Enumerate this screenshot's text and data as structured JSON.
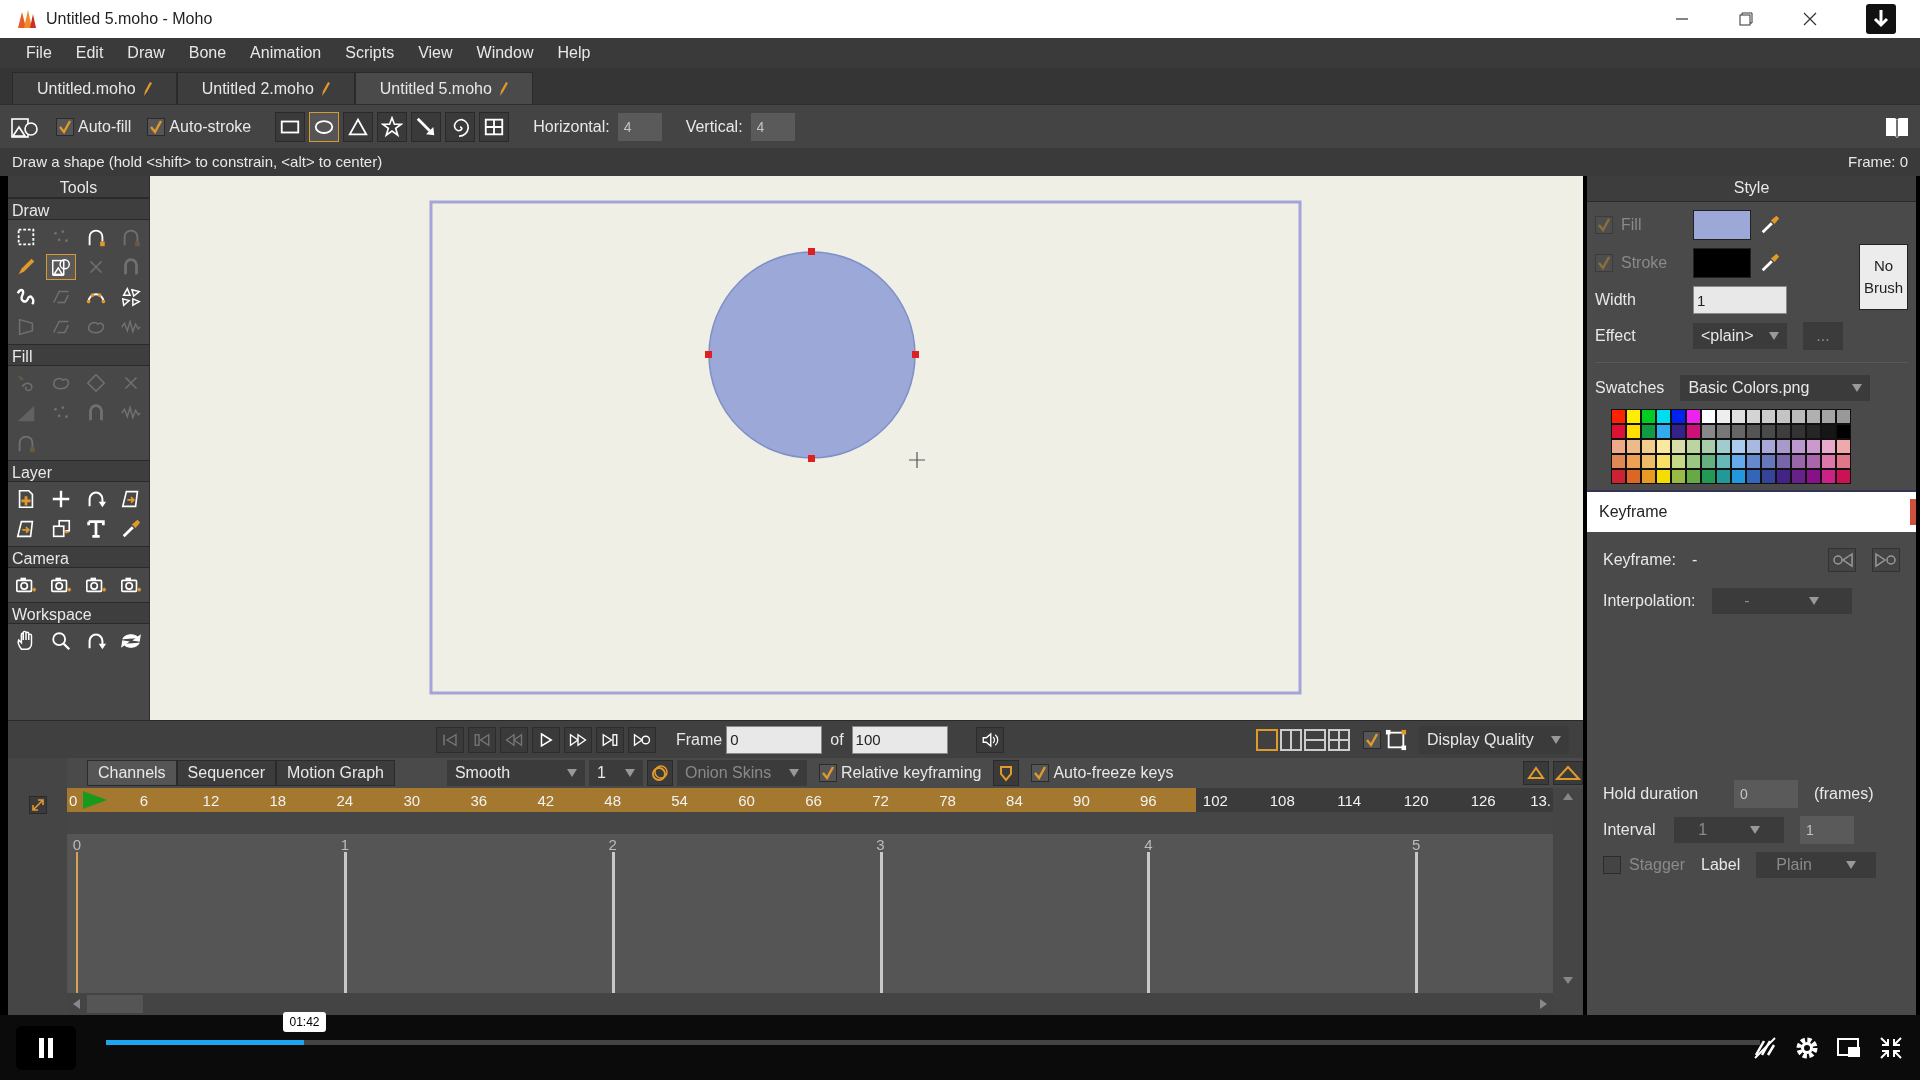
{
  "window": {
    "title": "Untitled 5.moho - Moho"
  },
  "menu": [
    "File",
    "Edit",
    "Draw",
    "Bone",
    "Animation",
    "Scripts",
    "View",
    "Window",
    "Help"
  ],
  "doc_tabs": [
    {
      "label": "Untitled.moho",
      "selected": false
    },
    {
      "label": "Untitled 2.moho",
      "selected": false
    },
    {
      "label": "Untitled 5.moho",
      "selected": true
    }
  ],
  "toolbar": {
    "auto_fill": {
      "label": "Auto-fill",
      "checked": true
    },
    "auto_stroke": {
      "label": "Auto-stroke",
      "checked": true
    },
    "shapes": [
      {
        "kind": "rect",
        "selected": false
      },
      {
        "kind": "ellipse",
        "selected": true
      },
      {
        "kind": "triangle",
        "selected": false
      },
      {
        "kind": "star",
        "selected": false
      },
      {
        "kind": "arrow",
        "selected": false
      },
      {
        "kind": "spiral",
        "selected": false
      },
      {
        "kind": "grid",
        "selected": false
      }
    ],
    "horizontal": {
      "label": "Horizontal:",
      "value": "4"
    },
    "vertical": {
      "label": "Vertical:",
      "value": "4"
    }
  },
  "status": {
    "hint": "Draw a shape (hold <shift> to constrain, <alt> to center)",
    "frame": "Frame: 0"
  },
  "tools": {
    "title": "Tools",
    "sections": [
      {
        "title": "Draw",
        "tools": [
          {
            "kind": "marquee",
            "selected": false,
            "disabled": false
          },
          {
            "kind": "dots",
            "selected": false,
            "disabled": true
          },
          {
            "kind": "arc",
            "selected": false,
            "disabled": false
          },
          {
            "kind": "arc",
            "selected": false,
            "disabled": true
          },
          {
            "kind": "pencil",
            "selected": false,
            "disabled": false
          },
          {
            "kind": "shape",
            "selected": true,
            "disabled": false
          },
          {
            "kind": "cross",
            "selected": false,
            "disabled": true
          },
          {
            "kind": "magnet",
            "selected": false,
            "disabled": true
          },
          {
            "kind": "freehand",
            "selected": false,
            "disabled": false
          },
          {
            "kind": "lines",
            "selected": false,
            "disabled": true
          },
          {
            "kind": "curvature",
            "selected": false,
            "disabled": false
          },
          {
            "kind": "triangles",
            "selected": false,
            "disabled": false
          },
          {
            "kind": "trapezoid",
            "selected": false,
            "disabled": true
          },
          {
            "kind": "lines",
            "selected": false,
            "disabled": true
          },
          {
            "kind": "blob",
            "selected": false,
            "disabled": true
          },
          {
            "kind": "wave",
            "selected": false,
            "disabled": true
          }
        ]
      },
      {
        "title": "Fill",
        "tools": [
          {
            "kind": "lasso",
            "selected": false,
            "disabled": true
          },
          {
            "kind": "blob",
            "selected": false,
            "disabled": true
          },
          {
            "kind": "diamond",
            "selected": false,
            "disabled": true
          },
          {
            "kind": "cross",
            "selected": false,
            "disabled": true
          },
          {
            "kind": "gradient",
            "selected": false,
            "disabled": true
          },
          {
            "kind": "dots",
            "selected": false,
            "disabled": true
          },
          {
            "kind": "magnet",
            "selected": false,
            "disabled": true
          },
          {
            "kind": "wave",
            "selected": false,
            "disabled": true
          },
          {
            "kind": "arc",
            "selected": false,
            "disabled": true
          }
        ]
      },
      {
        "title": "Layer",
        "tools": [
          {
            "kind": "layer-add",
            "selected": false,
            "disabled": false
          },
          {
            "kind": "plus",
            "selected": false,
            "disabled": false
          },
          {
            "kind": "rotate",
            "selected": false,
            "disabled": false
          },
          {
            "kind": "layer-tilt",
            "selected": false,
            "disabled": false
          },
          {
            "kind": "layer-tilt",
            "selected": false,
            "disabled": false
          },
          {
            "kind": "layers",
            "selected": false,
            "disabled": false
          },
          {
            "kind": "text",
            "selected": false,
            "disabled": false
          },
          {
            "kind": "dropper",
            "selected": false,
            "disabled": false
          }
        ]
      },
      {
        "title": "Camera",
        "tools": [
          {
            "kind": "camera",
            "selected": false,
            "disabled": false
          },
          {
            "kind": "camera",
            "selected": false,
            "disabled": false
          },
          {
            "kind": "camera",
            "selected": false,
            "disabled": false
          },
          {
            "kind": "camera",
            "selected": false,
            "disabled": false
          }
        ]
      },
      {
        "title": "Workspace",
        "tools": [
          {
            "kind": "hand",
            "selected": false,
            "disabled": false
          },
          {
            "kind": "zoom",
            "selected": false,
            "disabled": false
          },
          {
            "kind": "rotate",
            "selected": false,
            "disabled": false
          },
          {
            "kind": "orbit",
            "selected": false,
            "disabled": false
          }
        ]
      }
    ]
  },
  "style": {
    "title": "Style",
    "fill": {
      "label": "Fill",
      "checked": true,
      "color": "#9ba8d8"
    },
    "stroke": {
      "label": "Stroke",
      "checked": true,
      "color": "#000000"
    },
    "width": {
      "label": "Width",
      "value": "1"
    },
    "brush_button": "No Brush",
    "effect": {
      "label": "Effect",
      "value": "<plain>"
    },
    "more_button": "...",
    "swatches": {
      "label": "Swatches",
      "value": "Basic Colors.png",
      "items": [
        {
          "color": "#ff2200"
        },
        {
          "color": "#ffee00"
        },
        {
          "color": "#00cc22"
        },
        {
          "color": "#00ddee"
        },
        {
          "color": "#0022ee"
        },
        {
          "color": "#ee22ee"
        },
        {
          "color": "#ffffff"
        },
        {
          "color": "#eeeeee"
        },
        {
          "color": "#e0e0e0"
        },
        {
          "color": "#d4d4d4"
        },
        {
          "color": "#cccccc"
        },
        {
          "color": "#c4c4c4"
        },
        {
          "color": "#bbbbbb"
        },
        {
          "color": "#b0b0b0"
        },
        {
          "color": "#a4a4a4"
        },
        {
          "color": "#999999"
        },
        {
          "color": "#dd1133"
        },
        {
          "color": "#ffdd00"
        },
        {
          "color": "#119944"
        },
        {
          "color": "#33aaee"
        },
        {
          "color": "#332288"
        },
        {
          "color": "#cc1177"
        },
        {
          "color": "#888888"
        },
        {
          "color": "#777777"
        },
        {
          "color": "#666666"
        },
        {
          "color": "#555555"
        },
        {
          "color": "#4a4a4a"
        },
        {
          "color": "#3e3e3e"
        },
        {
          "color": "#333333"
        },
        {
          "color": "#262626"
        },
        {
          "color": "#161616"
        },
        {
          "color": "#000000"
        },
        {
          "color": "#eeaa88"
        },
        {
          "color": "#eebb88"
        },
        {
          "color": "#f2cc8c"
        },
        {
          "color": "#fbe8a0"
        },
        {
          "color": "#d8ddaa"
        },
        {
          "color": "#bbd4a0"
        },
        {
          "color": "#a8ccaa"
        },
        {
          "color": "#a0ccd0"
        },
        {
          "color": "#aaccee"
        },
        {
          "color": "#a8b8e0"
        },
        {
          "color": "#a8a8d8"
        },
        {
          "color": "#a898cc"
        },
        {
          "color": "#bb99cc"
        },
        {
          "color": "#cc99cc"
        },
        {
          "color": "#e8aacc"
        },
        {
          "color": "#eeaaaa"
        },
        {
          "color": "#e08855"
        },
        {
          "color": "#eea055"
        },
        {
          "color": "#eebb66"
        },
        {
          "color": "#fbe066"
        },
        {
          "color": "#c4d888"
        },
        {
          "color": "#99c880"
        },
        {
          "color": "#66b080"
        },
        {
          "color": "#66b8b8"
        },
        {
          "color": "#66aaee"
        },
        {
          "color": "#6688cc"
        },
        {
          "color": "#6677bb"
        },
        {
          "color": "#7766aa"
        },
        {
          "color": "#9966aa"
        },
        {
          "color": "#aa66aa"
        },
        {
          "color": "#dd77aa"
        },
        {
          "color": "#e07788"
        },
        {
          "color": "#cc2233"
        },
        {
          "color": "#dd6622"
        },
        {
          "color": "#e89922"
        },
        {
          "color": "#f4dd00"
        },
        {
          "color": "#99bb44"
        },
        {
          "color": "#66aa44"
        },
        {
          "color": "#229955"
        },
        {
          "color": "#229999"
        },
        {
          "color": "#2299dd"
        },
        {
          "color": "#3366bb"
        },
        {
          "color": "#334499"
        },
        {
          "color": "#442288"
        },
        {
          "color": "#662288"
        },
        {
          "color": "#881188"
        },
        {
          "color": "#cc2288"
        },
        {
          "color": "#cc1155"
        }
      ]
    }
  },
  "keyframe_popup": {
    "title": "Keyframe"
  },
  "keyframe": {
    "keyframe": {
      "label": "Keyframe:",
      "value": "-"
    },
    "interpolation": {
      "label": "Interpolation:",
      "value": "-"
    },
    "hold_duration": {
      "label": "Hold duration",
      "value": "0",
      "unit": "(frames)"
    },
    "interval": {
      "label": "Interval",
      "value": "1",
      "field": "1"
    },
    "stagger": {
      "label": "Stagger",
      "checked": false
    },
    "label": {
      "label": "Label",
      "value": "Plain"
    }
  },
  "playback": {
    "buttons": [
      {
        "kind": "first",
        "disabled": true
      },
      {
        "kind": "prev-key",
        "disabled": true
      },
      {
        "kind": "back",
        "disabled": true
      },
      {
        "kind": "play",
        "disabled": false
      },
      {
        "kind": "forward",
        "disabled": false
      },
      {
        "kind": "next-key",
        "disabled": false
      },
      {
        "kind": "last",
        "disabled": false
      }
    ],
    "frame_label": "Frame",
    "frame": "0",
    "of_label": "of",
    "total": "100",
    "views": [
      {
        "selected": true
      },
      {
        "selected": false
      },
      {
        "selected": false
      },
      {
        "selected": false
      }
    ],
    "view_check": {
      "checked": true
    },
    "quality": "Display Quality"
  },
  "timeline": {
    "tabs": [
      {
        "label": "Channels",
        "selected": true
      },
      {
        "label": "Sequencer",
        "selected": false
      },
      {
        "label": "Motion Graph",
        "selected": false
      }
    ],
    "interpolation": "Smooth",
    "interval": "1",
    "onion_skins": "Onion Skins",
    "relative_keyframing": {
      "label": "Relative keyframing",
      "checked": true
    },
    "auto_freeze": {
      "label": "Auto-freeze keys",
      "checked": true
    },
    "ruler": {
      "level": 0.76,
      "ticks": [
        "0",
        "6",
        "12",
        "18",
        "24",
        "30",
        "36",
        "42",
        "48",
        "54",
        "60",
        "66",
        "72",
        "78",
        "84",
        "90",
        "96",
        "102",
        "108",
        "114",
        "120",
        "126",
        "13."
      ]
    },
    "seconds": [
      "0",
      "1",
      "2",
      "3",
      "4",
      "5"
    ]
  },
  "video": {
    "level": 0.12,
    "time": "01:42"
  }
}
